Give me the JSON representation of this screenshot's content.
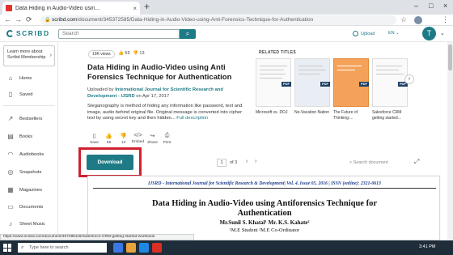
{
  "browser": {
    "tab_title": "Data Hiding in Audio-Video usin...",
    "tab_close": "×",
    "new_tab": "+",
    "window_controls": [
      "–",
      "□",
      "×"
    ],
    "nav_icons": [
      "←",
      "→",
      "⟳"
    ],
    "url_domain": "scribd.com",
    "url_path": "/document/345372585/Data-Hiding-in-Audio-Video-using-Anti-Forensics-Technique-for-Authentication",
    "star": "☆",
    "menu": "⋮",
    "status_url": "https://www.scribd.com/document/357485116/Salesforce-CRM-getting-started-workbook"
  },
  "header": {
    "logo": "SCRIBD",
    "search_placeholder": "Search",
    "search_icon": "⌕",
    "upload": "Upload",
    "lang": "EN ⌄",
    "user_initial": "T",
    "chevron": "⌄"
  },
  "sidebar": {
    "promo": "Learn more about Scribd Membership",
    "promo_arrow": "›",
    "items": [
      {
        "label": "Home",
        "icon": "home-icon",
        "glyph": "⌂"
      },
      {
        "label": "Saved",
        "icon": "bookmark-icon",
        "glyph": "▯"
      },
      {
        "label": "Bestsellers",
        "icon": "chart-icon",
        "glyph": "↗"
      },
      {
        "label": "Books",
        "icon": "book-icon",
        "glyph": "▤"
      },
      {
        "label": "Audiobooks",
        "icon": "headphones-icon",
        "glyph": "◠"
      },
      {
        "label": "Snapshots",
        "icon": "snapshot-icon",
        "glyph": "◎"
      },
      {
        "label": "Magazines",
        "icon": "magazine-icon",
        "glyph": "▦"
      },
      {
        "label": "Documents",
        "icon": "document-icon",
        "glyph": "▭"
      },
      {
        "label": "Sheet Music",
        "icon": "music-icon",
        "glyph": "♪"
      }
    ]
  },
  "document": {
    "views": "19K views",
    "likes": "59",
    "dislikes": "13",
    "title": "Data Hiding in Audio-Video using Anti Forensics Technique for Authentication",
    "uploaded_prefix": "Uploaded by",
    "uploader": "International Journal for Scientific Research and Development - IJSRD",
    "uploaded_suffix": "on Apr 17, 2017",
    "description": "Steganography is method of hiding any information like password, text and image, audio behind original file. Original message is converted into cipher text by using secret key and then hidden...",
    "full_description": "Full description",
    "actions": [
      {
        "label": "Save",
        "icon": "bookmark-icon",
        "glyph": "▯"
      },
      {
        "label": "59",
        "icon": "thumbs-up-icon",
        "glyph": "👍"
      },
      {
        "label": "13",
        "icon": "thumbs-down-icon",
        "glyph": "👎"
      },
      {
        "label": "Embed",
        "icon": "embed-icon",
        "glyph": "</>"
      },
      {
        "label": "Share",
        "icon": "share-icon",
        "glyph": "↪"
      },
      {
        "label": "Print",
        "icon": "print-icon",
        "glyph": "⎙"
      }
    ],
    "download": "Download"
  },
  "related": {
    "header": "RELATED TITLES",
    "badge": "PDF",
    "next": "›",
    "items": [
      {
        "title": "Microsoft vs. DOJ"
      },
      {
        "title": "No-Vacation Nation"
      },
      {
        "title": "The Future of Thinking:..."
      },
      {
        "title": "Salesforce CRM getting started..."
      }
    ]
  },
  "toolbar": {
    "page": "1",
    "of": "of 3",
    "prev": "‹",
    "next": "›",
    "search_placeholder": "Search document",
    "fullscreen": "⤢"
  },
  "paper": {
    "journal": "IJSRD - International Journal for Scientific Research & Development| Vol. 4, Issue 05, 2016 | ISSN (online): 2321-0613",
    "title_line1": "Data Hiding in Audio-Video using Antiforensics Technique for",
    "title_line2": "Authentication",
    "authors": "Mr.Sunil S. Khatal¹ Mr. K.S. Kahate²",
    "affil": "¹M.E Student ²M.E Co-Ordinator"
  },
  "taskbar": {
    "search_text": "Type here to search",
    "time": "3:41 PM",
    "app_colors": [
      "#3b78e7",
      "#e8a33d",
      "#1e88e5",
      "#d93025"
    ]
  }
}
